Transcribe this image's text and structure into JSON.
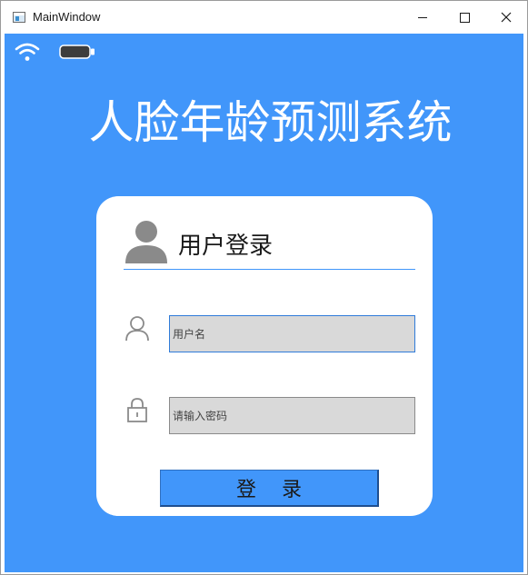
{
  "window": {
    "title": "MainWindow",
    "icons": {
      "app": "application-icon",
      "minimize": "minimize-icon",
      "maximize": "maximize-icon",
      "close": "close-icon"
    }
  },
  "status_bar": {
    "icons": [
      "wifi-icon",
      "battery-icon"
    ]
  },
  "header": {
    "title": "人脸年龄预测系统"
  },
  "login_card": {
    "title": "用户登录",
    "title_icon": "user-avatar-icon",
    "username": {
      "icon": "user-outline-icon",
      "placeholder": "用户名",
      "value": ""
    },
    "password": {
      "icon": "lock-icon",
      "placeholder": "请输入密码",
      "value": ""
    },
    "login_button_label": "登    录"
  },
  "colors": {
    "background": "#4196fa",
    "card": "#ffffff",
    "input_fill": "#d9d9d9",
    "icon_gray": "#8a8a8a",
    "heading_text": "#ffffff"
  }
}
